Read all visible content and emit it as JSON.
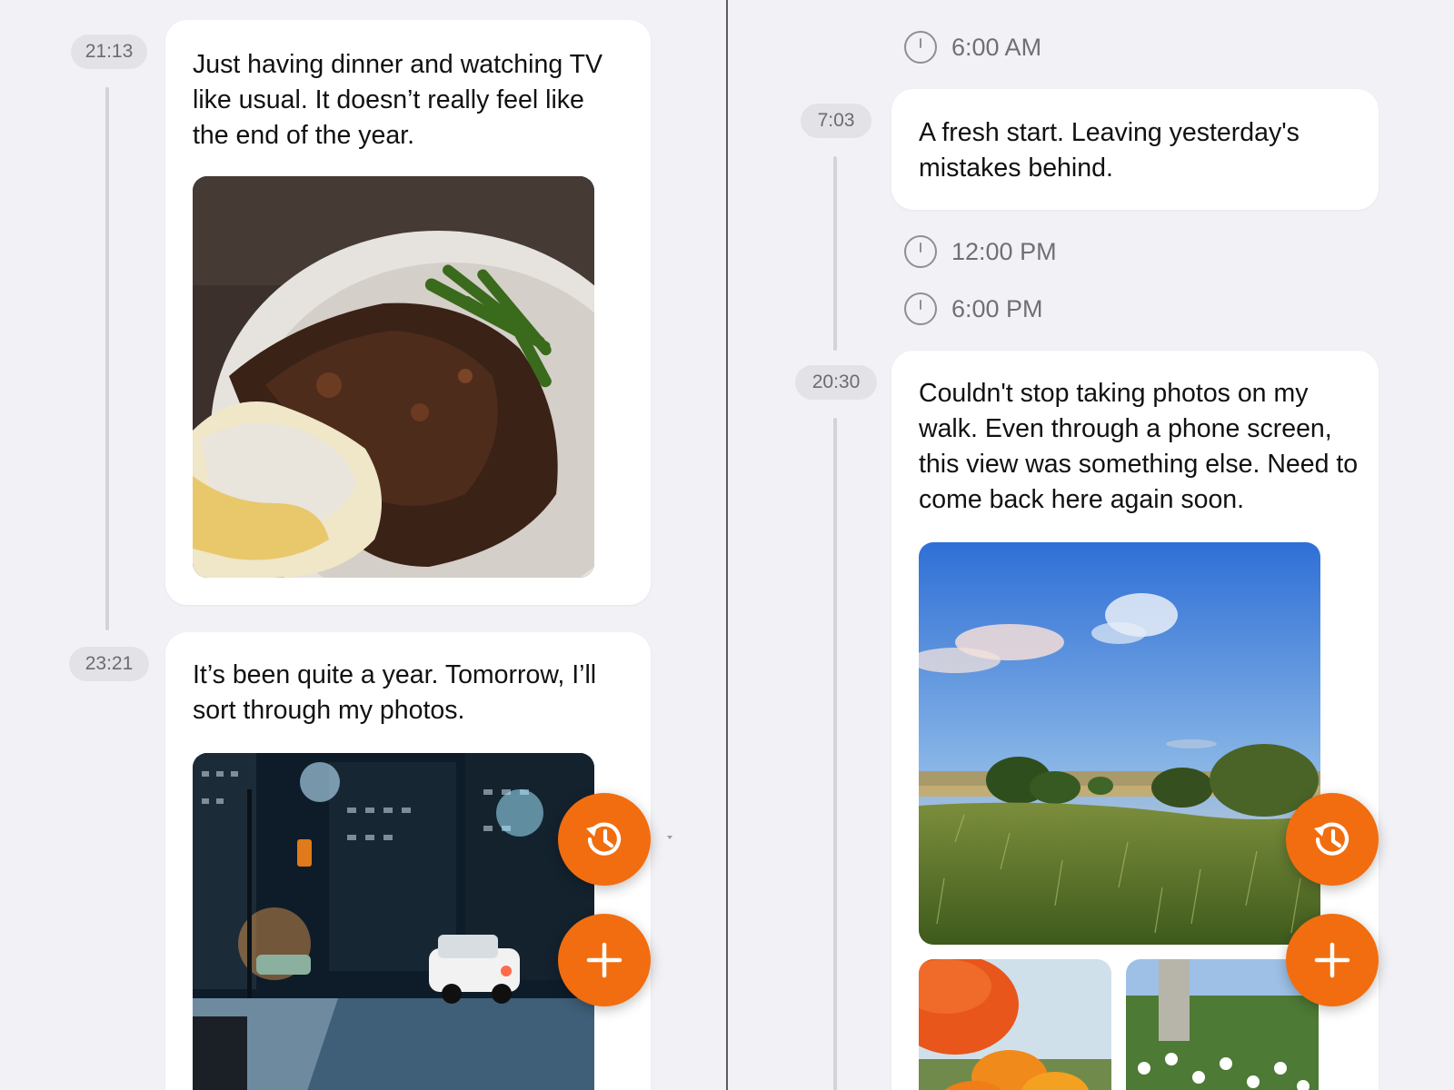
{
  "left_pane": {
    "entries": [
      {
        "time": "21:13",
        "text": "Just having dinner and watching TV like usual. It doesn’t really feel like the end of the year.",
        "photo_icon": "dinner-plate-photo"
      },
      {
        "time": "23:21",
        "text": "It’s been quite a year. Tomorrow, I’ll sort through my photos.",
        "photo_icon": "snowy-city-street-photo"
      }
    ],
    "fab_history_icon": "history-icon",
    "fab_add_icon": "plus-icon"
  },
  "right_pane": {
    "markers": [
      {
        "label": "6:00 AM"
      },
      {
        "label": "12:00 PM"
      },
      {
        "label": "6:00 PM"
      }
    ],
    "entries": [
      {
        "time": "7:03",
        "text": "A fresh start. Leaving yesterday's mistakes behind."
      },
      {
        "time": "20:30",
        "text": "Couldn't stop taking photos on my walk. Even through a phone screen, this view was something else. Need to come back here again soon.",
        "photo_icons": [
          "meadow-landscape-photo",
          "orange-poppies-photo",
          "white-flowers-tree-photo"
        ]
      }
    ],
    "fab_history_icon": "history-icon",
    "fab_add_icon": "plus-icon"
  },
  "colors": {
    "background": "#f2f2f6",
    "card": "#ffffff",
    "accent": "#f26d0f",
    "pill": "#e3e3e7",
    "pill_text": "#6c6c70",
    "rail": "#d3d3d8"
  }
}
